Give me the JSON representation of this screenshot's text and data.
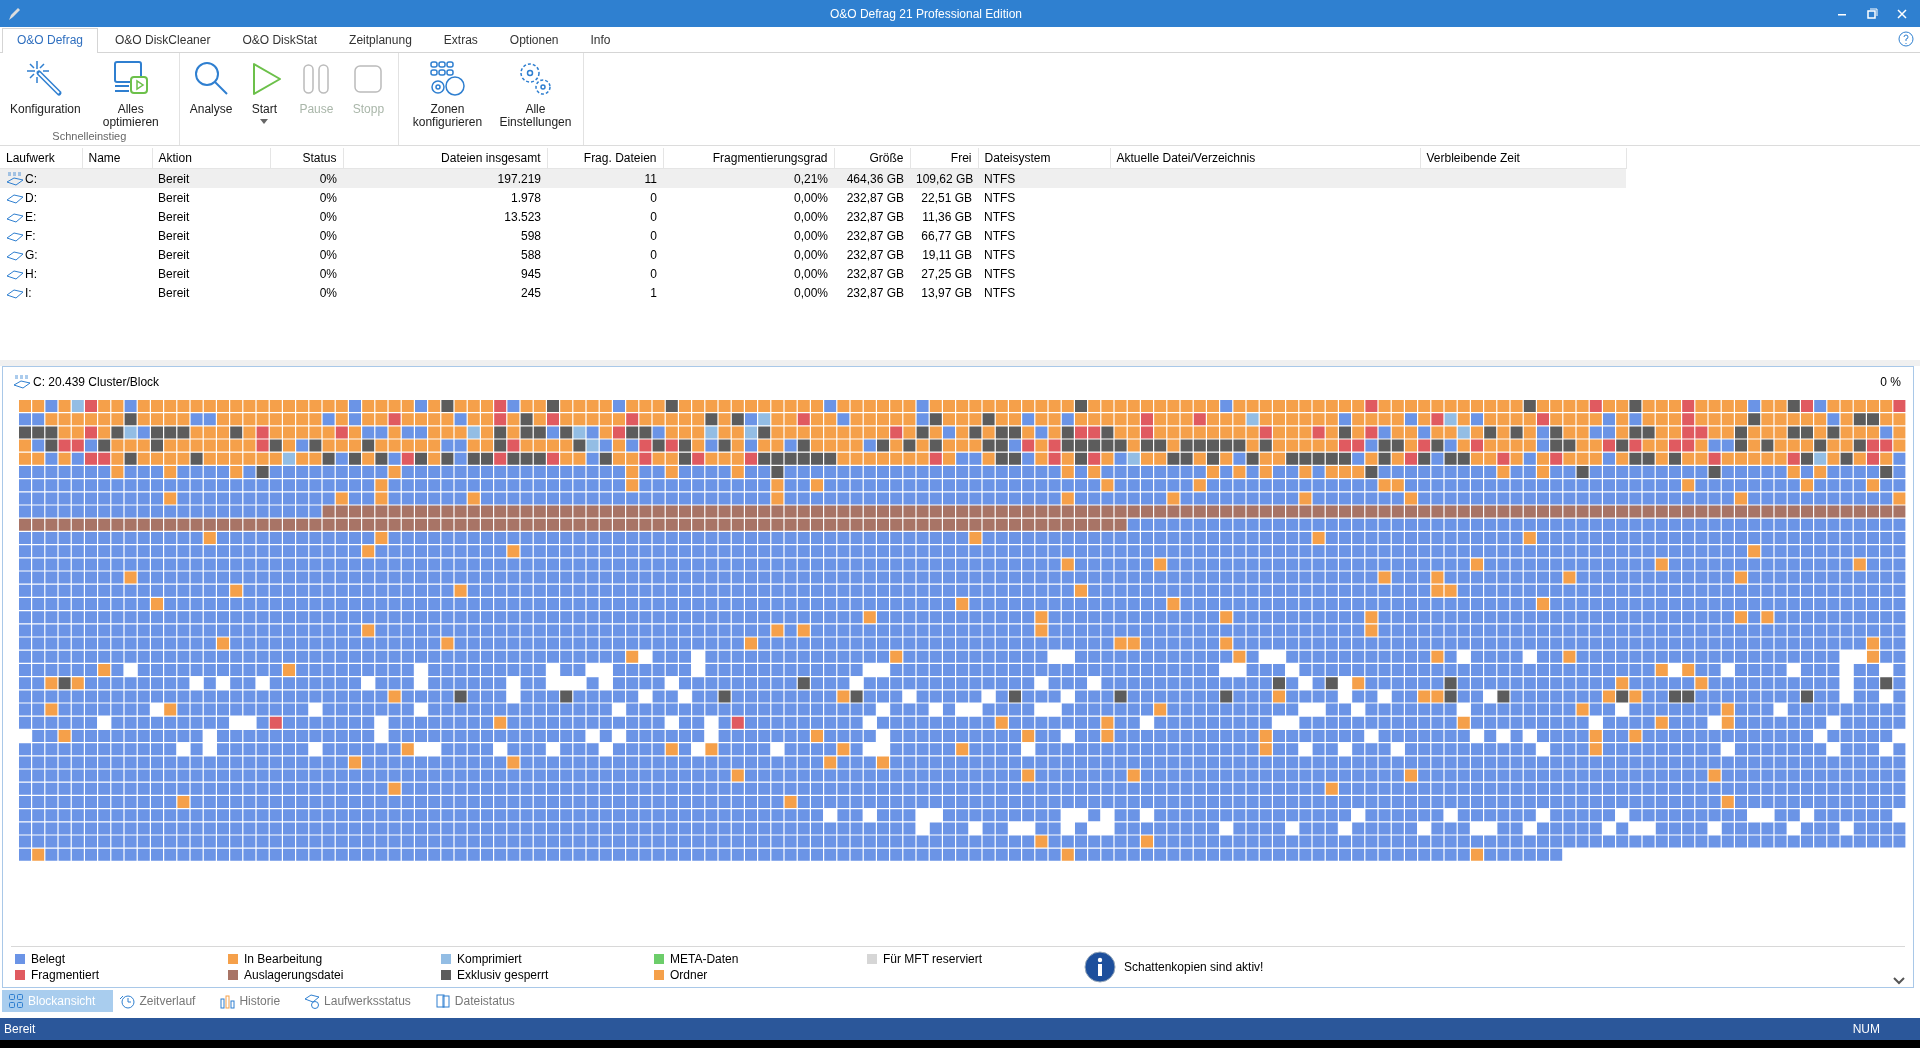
{
  "window": {
    "title": "O&O Defrag 21 Professional Edition"
  },
  "tabs": [
    {
      "label": "O&O Defrag",
      "selected": true
    },
    {
      "label": "O&O DiskCleaner",
      "selected": false
    },
    {
      "label": "O&O DiskStat",
      "selected": false
    },
    {
      "label": "Zeitplanung",
      "selected": false
    },
    {
      "label": "Extras",
      "selected": false
    },
    {
      "label": "Optionen",
      "selected": false
    },
    {
      "label": "Info",
      "selected": false
    }
  ],
  "ribbon": [
    {
      "group_label": "Schnelleinstieg",
      "buttons": [
        {
          "label": "Konfiguration",
          "disabled": false,
          "dropdown": false
        },
        {
          "label": "Alles optimieren",
          "disabled": false,
          "dropdown": false
        }
      ]
    },
    {
      "buttons": [
        {
          "label": "Analyse",
          "disabled": false,
          "dropdown": false
        },
        {
          "label": "Start",
          "disabled": false,
          "dropdown": true
        },
        {
          "label": "Pause",
          "disabled": true,
          "dropdown": false
        },
        {
          "label": "Stopp",
          "disabled": true,
          "dropdown": false
        }
      ]
    },
    {
      "buttons": [
        {
          "label": "Zonen konfigurieren",
          "disabled": false,
          "dropdown": false
        },
        {
          "label": "Alle Einstellungen",
          "disabled": false,
          "dropdown": false
        }
      ]
    }
  ],
  "table": {
    "columns": [
      {
        "label": "Laufwerk"
      },
      {
        "label": "Name"
      },
      {
        "label": "Aktion"
      },
      {
        "label": "Status"
      },
      {
        "label": "Dateien insgesamt"
      },
      {
        "label": "Frag. Dateien"
      },
      {
        "label": "Fragmentierungsgrad"
      },
      {
        "label": "Größe"
      },
      {
        "label": "Frei"
      },
      {
        "label": "Dateisystem"
      },
      {
        "label": "Aktuelle Datei/Verzeichnis"
      },
      {
        "label": "Verbleibende Zeit"
      }
    ],
    "rows": [
      {
        "kind": "ssd",
        "selected": true,
        "cells": [
          "C:",
          "",
          "Bereit",
          "0%",
          "197.219",
          "11",
          "0,21%",
          "464,36 GB",
          "109,62 GB",
          "NTFS",
          "",
          ""
        ]
      },
      {
        "kind": "hdd",
        "selected": false,
        "cells": [
          "D:",
          "",
          "Bereit",
          "0%",
          "1.978",
          "0",
          "0,00%",
          "232,87 GB",
          "22,51 GB",
          "NTFS",
          "",
          ""
        ]
      },
      {
        "kind": "hdd",
        "selected": false,
        "cells": [
          "E:",
          "",
          "Bereit",
          "0%",
          "13.523",
          "0",
          "0,00%",
          "232,87 GB",
          "11,36 GB",
          "NTFS",
          "",
          ""
        ]
      },
      {
        "kind": "hdd",
        "selected": false,
        "cells": [
          "F:",
          "",
          "Bereit",
          "0%",
          "598",
          "0",
          "0,00%",
          "232,87 GB",
          "66,77 GB",
          "NTFS",
          "",
          ""
        ]
      },
      {
        "kind": "hdd",
        "selected": false,
        "cells": [
          "G:",
          "",
          "Bereit",
          "0%",
          "588",
          "0",
          "0,00%",
          "232,87 GB",
          "19,11 GB",
          "NTFS",
          "",
          ""
        ]
      },
      {
        "kind": "hdd",
        "selected": false,
        "cells": [
          "H:",
          "",
          "Bereit",
          "0%",
          "945",
          "0",
          "0,00%",
          "232,87 GB",
          "27,25 GB",
          "NTFS",
          "",
          ""
        ]
      },
      {
        "kind": "hdd",
        "selected": false,
        "cells": [
          "I:",
          "",
          "Bereit",
          "0%",
          "245",
          "1",
          "0,00%",
          "232,87 GB",
          "13,97 GB",
          "NTFS",
          "",
          ""
        ]
      }
    ]
  },
  "block_view": {
    "drive_label": "C: 20.439 Cluster/Block",
    "progress": "0 %"
  },
  "legend": [
    {
      "label": "Belegt",
      "color": "#6b94e6"
    },
    {
      "label": "Fragmentiert",
      "color": "#e05a60"
    },
    {
      "label": "In Bearbeitung",
      "color": "#f5a04a"
    },
    {
      "label": "Auslagerungsdatei",
      "color": "#a87466"
    },
    {
      "label": "Komprimiert",
      "color": "#93bde4"
    },
    {
      "label": "Exklusiv gesperrt",
      "color": "#5c5c5c"
    },
    {
      "label": "META-Daten",
      "color": "#6ccd6a"
    },
    {
      "label": "Ordner",
      "color": "#f5a04a"
    },
    {
      "label": "Für MFT reserviert",
      "color": "#d6d6d6"
    }
  ],
  "info": {
    "text": "Schattenkopien sind aktiv!"
  },
  "view_tabs": [
    {
      "label": "Blockansicht",
      "selected": true
    },
    {
      "label": "Zeitverlauf",
      "selected": false
    },
    {
      "label": "Historie",
      "selected": false
    },
    {
      "label": "Laufwerksstatus",
      "selected": false
    },
    {
      "label": "Dateistatus",
      "selected": false
    }
  ],
  "status_bar": {
    "left": "Bereit",
    "right": "NUM"
  }
}
